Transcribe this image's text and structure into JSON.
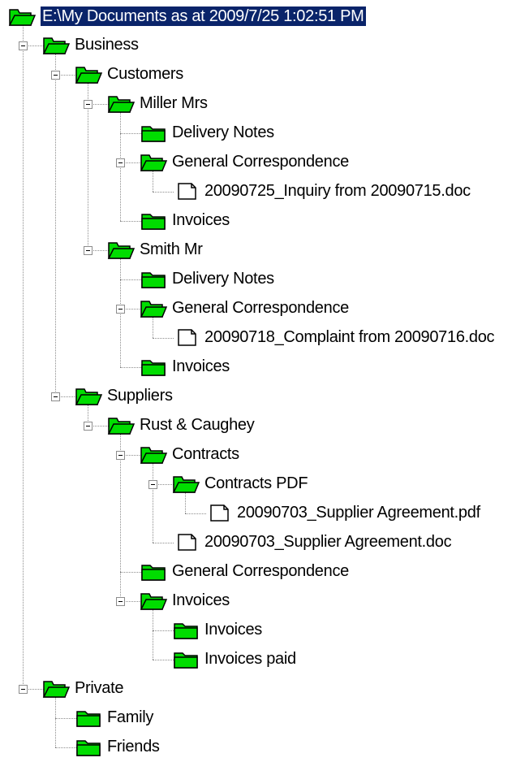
{
  "tree": {
    "root": {
      "label": "E:\\My Documents as at 2009/7/25 1:02:51 PM",
      "icon": "folder-open-icon",
      "selected": true
    },
    "items": [
      {
        "label": "Business",
        "depth": 1,
        "icon": "folder-open-icon",
        "expanded": true
      },
      {
        "label": "Customers",
        "depth": 2,
        "icon": "folder-open-icon",
        "expanded": true
      },
      {
        "label": "Miller Mrs",
        "depth": 3,
        "icon": "folder-open-icon",
        "expanded": true
      },
      {
        "label": "Delivery Notes",
        "depth": 4,
        "icon": "folder-closed-icon"
      },
      {
        "label": "General Correspondence",
        "depth": 4,
        "icon": "folder-open-icon",
        "expanded": true
      },
      {
        "label": "20090725_Inquiry from 20090715.doc",
        "depth": 5,
        "icon": "file-icon"
      },
      {
        "label": "Invoices",
        "depth": 4,
        "icon": "folder-closed-icon"
      },
      {
        "label": "Smith Mr",
        "depth": 3,
        "icon": "folder-open-icon",
        "expanded": true
      },
      {
        "label": "Delivery Notes",
        "depth": 4,
        "icon": "folder-closed-icon"
      },
      {
        "label": "General Correspondence",
        "depth": 4,
        "icon": "folder-open-icon",
        "expanded": true
      },
      {
        "label": "20090718_Complaint from 20090716.doc",
        "depth": 5,
        "icon": "file-icon"
      },
      {
        "label": "Invoices",
        "depth": 4,
        "icon": "folder-closed-icon"
      },
      {
        "label": "Suppliers",
        "depth": 2,
        "icon": "folder-open-icon",
        "expanded": true
      },
      {
        "label": "Rust & Caughey",
        "depth": 3,
        "icon": "folder-open-icon",
        "expanded": true
      },
      {
        "label": "Contracts",
        "depth": 4,
        "icon": "folder-open-icon",
        "expanded": true
      },
      {
        "label": "Contracts PDF",
        "depth": 5,
        "icon": "folder-open-icon",
        "expanded": true
      },
      {
        "label": "20090703_Supplier Agreement.pdf",
        "depth": 6,
        "icon": "file-icon"
      },
      {
        "label": "20090703_Supplier Agreement.doc",
        "depth": 5,
        "icon": "file-icon"
      },
      {
        "label": "General Correspondence",
        "depth": 4,
        "icon": "folder-closed-icon"
      },
      {
        "label": "Invoices",
        "depth": 4,
        "icon": "folder-open-icon",
        "expanded": true
      },
      {
        "label": "Invoices",
        "depth": 5,
        "icon": "folder-closed-icon"
      },
      {
        "label": "Invoices paid",
        "depth": 5,
        "icon": "folder-closed-icon"
      },
      {
        "label": "Private",
        "depth": 1,
        "icon": "folder-open-icon",
        "expanded": true
      },
      {
        "label": "Family",
        "depth": 2,
        "icon": "folder-closed-icon"
      },
      {
        "label": "Friends",
        "depth": 2,
        "icon": "folder-closed-icon"
      }
    ]
  },
  "colors": {
    "folder_fill": "#00dd00",
    "folder_outline": "#000000",
    "selection": "#0a246a",
    "connector": "#8c8c8c"
  }
}
